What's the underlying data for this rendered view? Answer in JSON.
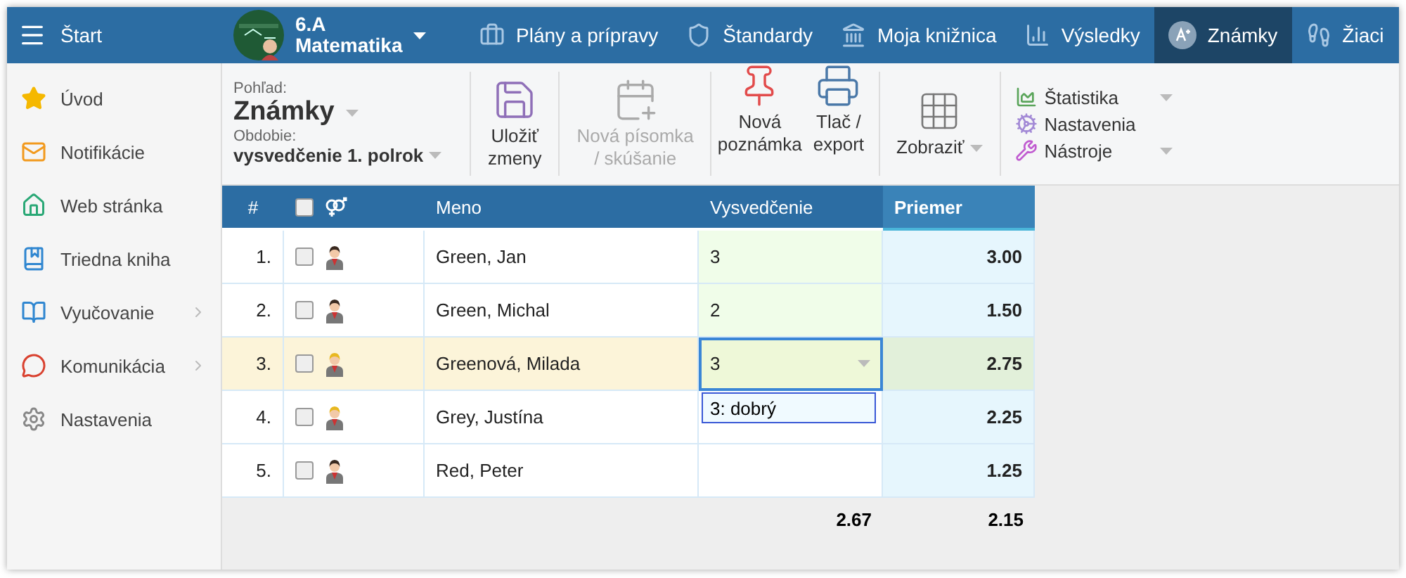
{
  "topbar": {
    "menu_label": "Štart",
    "class_name": "6.A",
    "subject": "Matematika",
    "nav": [
      {
        "label": "Plány a prípravy",
        "selected": false
      },
      {
        "label": "Štandardy",
        "selected": false
      },
      {
        "label": "Moja knižnica",
        "selected": false
      },
      {
        "label": "Výsledky",
        "selected": false
      },
      {
        "label": "Známky",
        "selected": true
      },
      {
        "label": "Žiaci",
        "selected": false
      }
    ]
  },
  "sidebar": {
    "items": [
      {
        "label": "Úvod",
        "expandable": false
      },
      {
        "label": "Notifikácie",
        "expandable": false
      },
      {
        "label": "Web stránka",
        "expandable": false
      },
      {
        "label": "Triedna kniha",
        "expandable": false
      },
      {
        "label": "Vyučovanie",
        "expandable": true
      },
      {
        "label": "Komunikácia",
        "expandable": true
      },
      {
        "label": "Nastavenia",
        "expandable": false
      }
    ]
  },
  "toolbar": {
    "view_label": "Pohľad:",
    "view_value": "Známky",
    "period_label": "Obdobie:",
    "period_value": "vysvedčenie 1. polrok",
    "buttons": [
      {
        "label": "Uložiť\nzmeny",
        "disabled": false
      },
      {
        "label": "Nová písomka\n/ skúšanie",
        "disabled": true
      },
      {
        "label": "Nová\npoznámka",
        "disabled": false
      },
      {
        "label": "Tlač /\nexport",
        "disabled": false
      }
    ],
    "display_label": "Zobraziť",
    "menu": [
      {
        "label": "Štatistika",
        "has_dropdown": true
      },
      {
        "label": "Nastavenia",
        "has_dropdown": false
      },
      {
        "label": "Nástroje",
        "has_dropdown": true
      }
    ]
  },
  "table": {
    "columns": [
      "#",
      "Meno",
      "Vysvedčenie",
      "Priemer"
    ],
    "select_all_checked": false,
    "rows": [
      {
        "number": "1.",
        "checked": false,
        "kind": "male",
        "name": "Green, Jan",
        "grade": "3",
        "average": "3.00",
        "selected": false
      },
      {
        "number": "2.",
        "checked": false,
        "kind": "male",
        "name": "Green, Michal",
        "grade": "2",
        "average": "1.50",
        "selected": false
      },
      {
        "number": "3.",
        "checked": false,
        "kind": "female",
        "name": "Greenová, Milada",
        "grade": "3",
        "average": "2.75",
        "selected": true
      },
      {
        "number": "4.",
        "checked": false,
        "kind": "female",
        "name": "Grey, Justína",
        "grade": "",
        "average": "2.25",
        "selected": false
      },
      {
        "number": "5.",
        "checked": false,
        "kind": "male",
        "name": "Red, Peter",
        "grade": "",
        "average": "1.25",
        "selected": false
      }
    ],
    "grade_option": "3: dobrý",
    "footer": {
      "grade_average": "2.67",
      "average": "2.15"
    }
  }
}
